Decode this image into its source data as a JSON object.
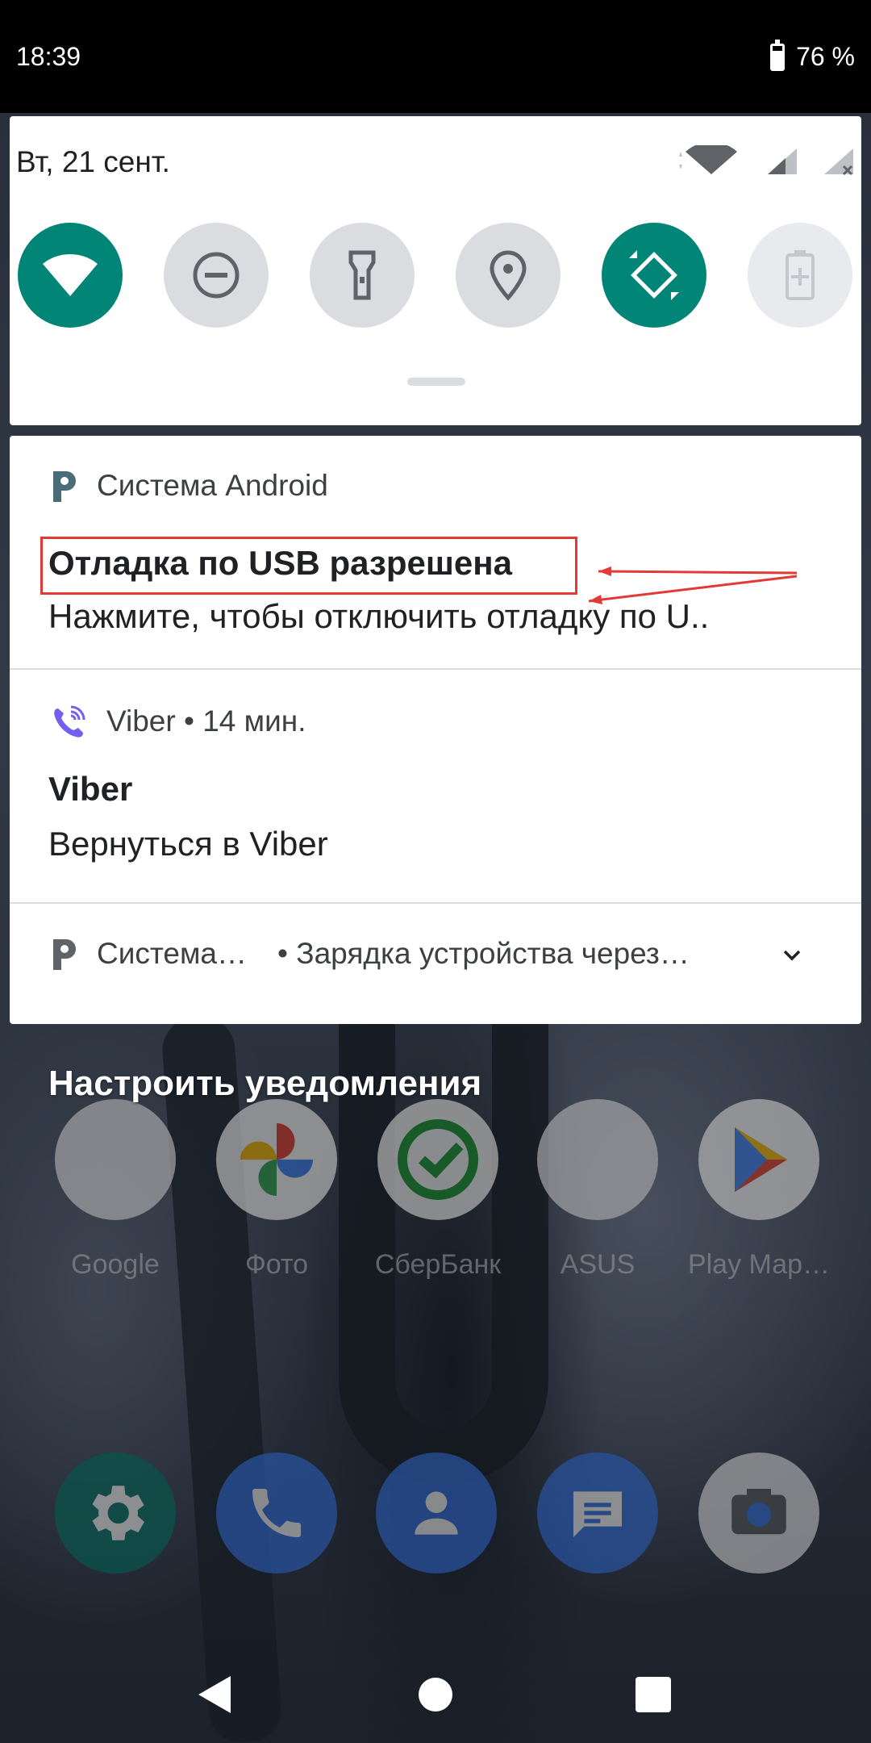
{
  "status_bar": {
    "time": "18:39",
    "battery": "76 %"
  },
  "quick_settings": {
    "date": "Вт, 21 сент.",
    "tiles": [
      {
        "name": "wifi",
        "state": "on"
      },
      {
        "name": "do-not-disturb",
        "state": "off"
      },
      {
        "name": "flashlight",
        "state": "off"
      },
      {
        "name": "location",
        "state": "off"
      },
      {
        "name": "auto-rotate",
        "state": "on"
      },
      {
        "name": "battery-saver",
        "state": "disabled"
      }
    ]
  },
  "notifications": [
    {
      "app": "Система Android",
      "title": "Отладка по USB разрешена",
      "text": "Нажмите, чтобы отключить отладку по U.."
    },
    {
      "app": "Viber • 14 мин.",
      "title": "Viber",
      "text": "Вернуться в Viber"
    },
    {
      "app": "Система…",
      "text": "• Зарядка устройства через…"
    }
  ],
  "setup_notifications": "Настроить уведомления",
  "home_apps": [
    {
      "label": "Google"
    },
    {
      "label": "Фото"
    },
    {
      "label": "СберБанк"
    },
    {
      "label": "ASUS"
    },
    {
      "label": "Play Мар…"
    }
  ],
  "colors": {
    "accent": "#008577",
    "annotation": "#e53935"
  }
}
